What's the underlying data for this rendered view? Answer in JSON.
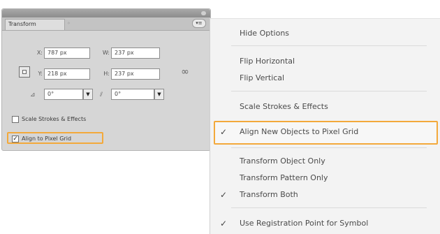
{
  "panel": {
    "tab_label": "Transform",
    "menu_button_icon": "panel-menu-icon",
    "x": {
      "label": "X:",
      "value": "787 px"
    },
    "y": {
      "label": "Y:",
      "value": "218 px"
    },
    "w": {
      "label": "W:",
      "value": "237 px"
    },
    "h": {
      "label": "H:",
      "value": "237 px"
    },
    "rotate": {
      "value": "0°"
    },
    "shear": {
      "value": "0°"
    },
    "scale_strokes": {
      "label": "Scale Strokes & Effects",
      "checked": false
    },
    "align_pixel": {
      "label": "Align to Pixel Grid",
      "checked": true
    }
  },
  "menu": {
    "items": [
      {
        "label": "Hide Options",
        "checked": false
      },
      {
        "label": "Flip Horizontal",
        "checked": false
      },
      {
        "label": "Flip Vertical",
        "checked": false
      },
      {
        "label": "Scale Strokes & Effects",
        "checked": false
      },
      {
        "label": "Align New Objects to Pixel Grid",
        "checked": true
      },
      {
        "label": "Transform Object Only",
        "checked": false
      },
      {
        "label": "Transform Pattern Only",
        "checked": false
      },
      {
        "label": "Transform Both",
        "checked": true
      },
      {
        "label": "Use Registration Point for Symbol",
        "checked": true
      }
    ],
    "check_glyph": "✓"
  },
  "colors": {
    "highlight": "#f3a93b"
  }
}
